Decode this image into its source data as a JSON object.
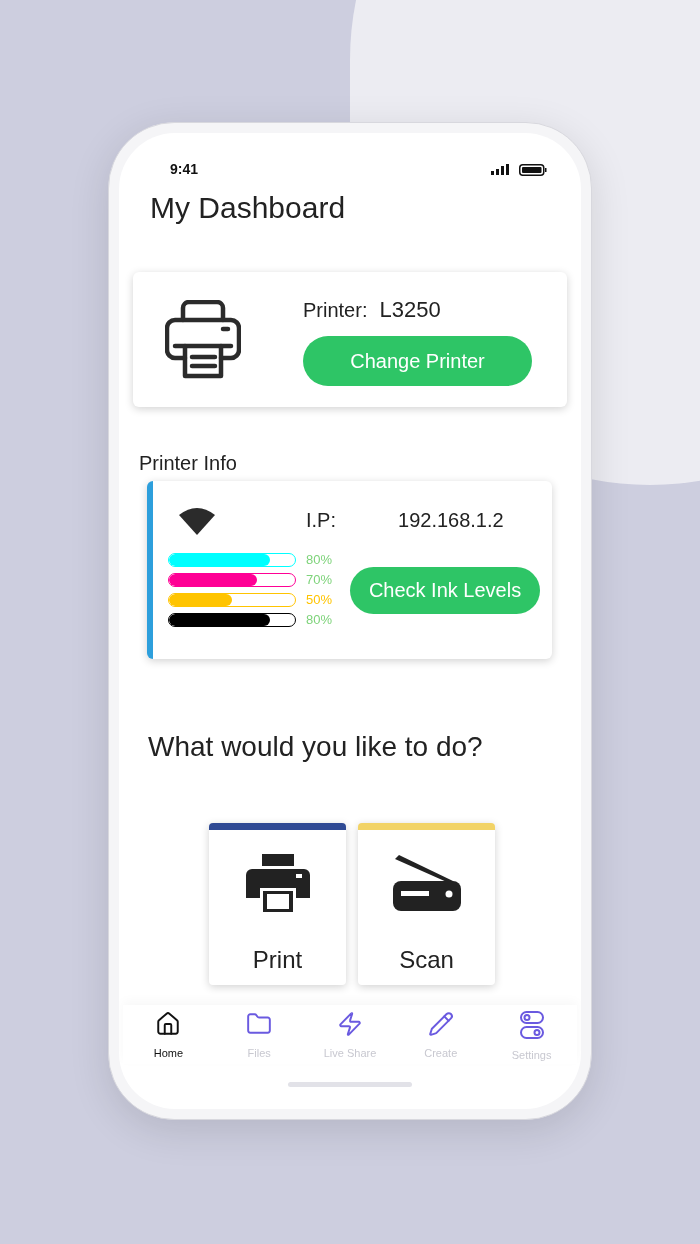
{
  "status_bar": {
    "time": "9:41"
  },
  "title": "My Dashboard",
  "printer_card": {
    "label": "Printer:",
    "model": "L3250",
    "button": "Change Printer"
  },
  "printer_info": {
    "heading": "Printer Info",
    "ip_label": "I.P:",
    "ip": "192.168.1.2",
    "button": "Check Ink Levels",
    "inks": [
      {
        "color": "#00ffff",
        "level": 0.8,
        "reading": "80%",
        "low": false
      },
      {
        "color": "#ff0095",
        "level": 0.7,
        "reading": "70%",
        "low": false
      },
      {
        "color": "#ffc400",
        "level": 0.5,
        "reading": "50%",
        "low": true
      },
      {
        "color": "#000000",
        "level": 0.8,
        "reading": "80%",
        "low": false
      }
    ]
  },
  "question": "What would you like to do?",
  "actions": [
    {
      "kind": "print",
      "label": "Print",
      "color": "#2f4a94"
    },
    {
      "kind": "scan",
      "label": "Scan",
      "color": "#f2d366"
    }
  ],
  "nav": [
    {
      "kind": "home",
      "label": "Home",
      "selected": true
    },
    {
      "kind": "files",
      "label": "Files",
      "selected": false
    },
    {
      "kind": "share",
      "label": "Live Share",
      "selected": false
    },
    {
      "kind": "create",
      "label": "Create",
      "selected": false
    },
    {
      "kind": "settings",
      "label": "Settings",
      "selected": false
    }
  ]
}
